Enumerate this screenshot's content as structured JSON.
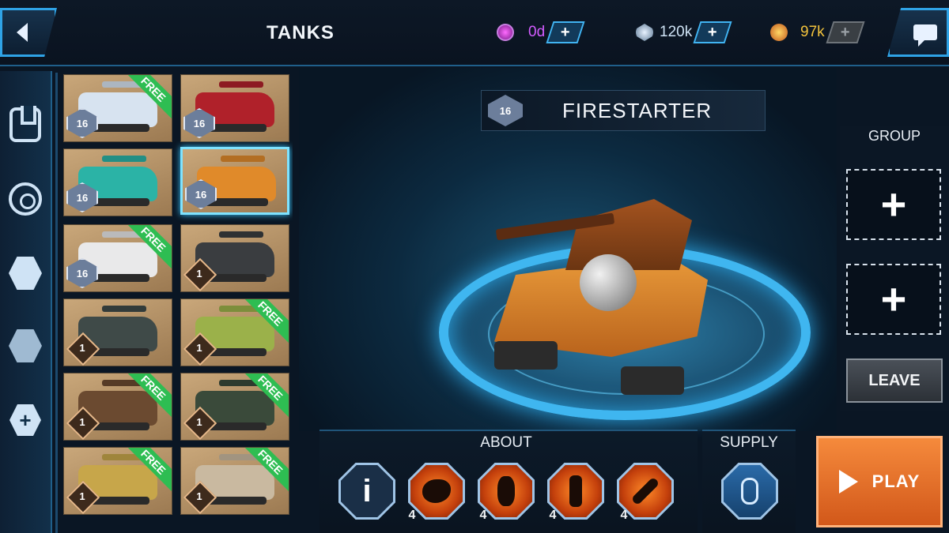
{
  "header": {
    "title": "TANKS",
    "currencies": [
      {
        "icon": "gem-icon",
        "value": "0d",
        "color": "#d35cff"
      },
      {
        "icon": "crystal-icon",
        "value": "120k",
        "color": "#cfe3f5"
      },
      {
        "icon": "star-medal-icon",
        "value": "97k",
        "color": "#f2c23c"
      }
    ]
  },
  "tanks": [
    {
      "level": "16",
      "free": "FREE",
      "color": "#d7e3f0"
    },
    {
      "level": "16",
      "free": "",
      "color": "#b0212a"
    },
    {
      "level": "16",
      "free": "",
      "color": "#2bb3a6"
    },
    {
      "level": "16",
      "free": "",
      "color": "#e08a2a",
      "selected": true
    },
    {
      "level": "16",
      "free": "FREE",
      "color": "#e9e9ea"
    },
    {
      "level": "1",
      "free": "",
      "color": "#3a3d40"
    },
    {
      "level": "1",
      "free": "",
      "color": "#3f4a48"
    },
    {
      "level": "1",
      "free": "FREE",
      "color": "#9bb14a"
    },
    {
      "level": "1",
      "free": "FREE",
      "color": "#6b4a30"
    },
    {
      "level": "1",
      "free": "FREE",
      "color": "#3a4a3a"
    },
    {
      "level": "1",
      "free": "FREE",
      "color": "#c7a64a"
    },
    {
      "level": "1",
      "free": "FREE",
      "color": "#c9b9a0"
    }
  ],
  "selected_tank": {
    "name": "FIRESTARTER",
    "level": "16"
  },
  "group": {
    "title": "GROUP",
    "slot1": "+",
    "slot2": "+",
    "leave_label": "LEAVE"
  },
  "about": {
    "label": "ABOUT",
    "info_symbol": "i",
    "abilities": [
      {
        "icon": "explosion-icon",
        "count": "4"
      },
      {
        "icon": "flame-shield-icon",
        "count": "4"
      },
      {
        "icon": "burning-pylon-icon",
        "count": "4"
      },
      {
        "icon": "fire-wrench-icon",
        "count": "4"
      }
    ]
  },
  "supply": {
    "label": "SUPPLY",
    "icon": "supply-canister-icon"
  },
  "play_label": "PLAY",
  "colors": {
    "accent": "#2fa3e6",
    "play": "#f07a2e",
    "free_ribbon": "#2ebd52"
  }
}
